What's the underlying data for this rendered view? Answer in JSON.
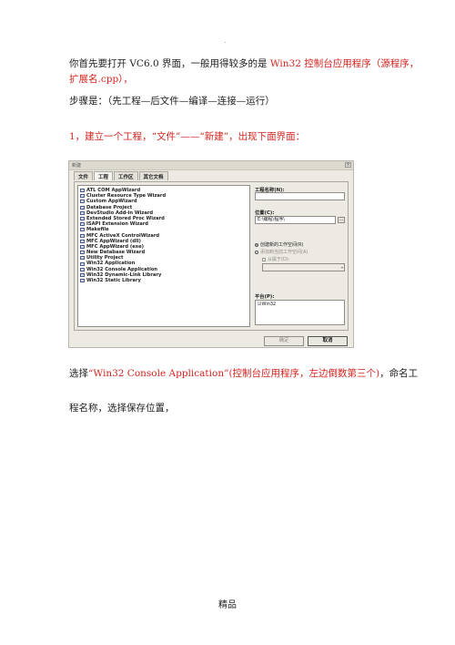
{
  "doc": {
    "dot": ".",
    "line1_black": "你首先要打开 VC6.0 界面，一般用得较多的是 ",
    "line1_red": "Win32 控制台应用程序（源程序，",
    "line2_red": "扩展名.cpp），",
    "steps": "步骤是：（先工程—后文件—编译—连接—运行）",
    "step1": "1，建立一个工程，“文件”——“新建”，出现下面界面：",
    "select_black1": "选择",
    "select_red": "“Win32 Console Application”(控制台应用程序，左边倒数第三个)",
    "select_black2": "，命名工",
    "line_after": "程名称，选择保存位置，",
    "footer": "精品"
  },
  "dialog": {
    "title": "新建",
    "close": "×",
    "tabs": [
      "文件",
      "工程",
      "工作区",
      "其它文档"
    ],
    "project_types": [
      "ATL COM AppWizard",
      "Cluster Resource Type Wizard",
      "Custom AppWizard",
      "Database Project",
      "DevStudio Add-in Wizard",
      "Extended Stored Proc Wizard",
      "ISAPI Extension Wizard",
      "Makefile",
      "MFC ActiveX ControlWizard",
      "MFC AppWizard (dll)",
      "MFC AppWizard (exe)",
      "New Database Wizard",
      "Utility Project",
      "Win32 Application",
      "Win32 Console Application",
      "Win32 Dynamic-Link Library",
      "Win32 Static Library"
    ],
    "project_name_label": "工程名称(N):",
    "project_name_value": "",
    "location_label": "位置(C):",
    "location_value": "E:\\编程\\程序\\",
    "browse": "...",
    "radio_new": "创建新的工作空间(R)",
    "radio_add": "添加到当前工作空间(A)",
    "check_dep": "从属于(D):",
    "platform_label": "平台(P):",
    "platform_value": "☑Win32",
    "ok": "确定",
    "cancel": "取消"
  }
}
